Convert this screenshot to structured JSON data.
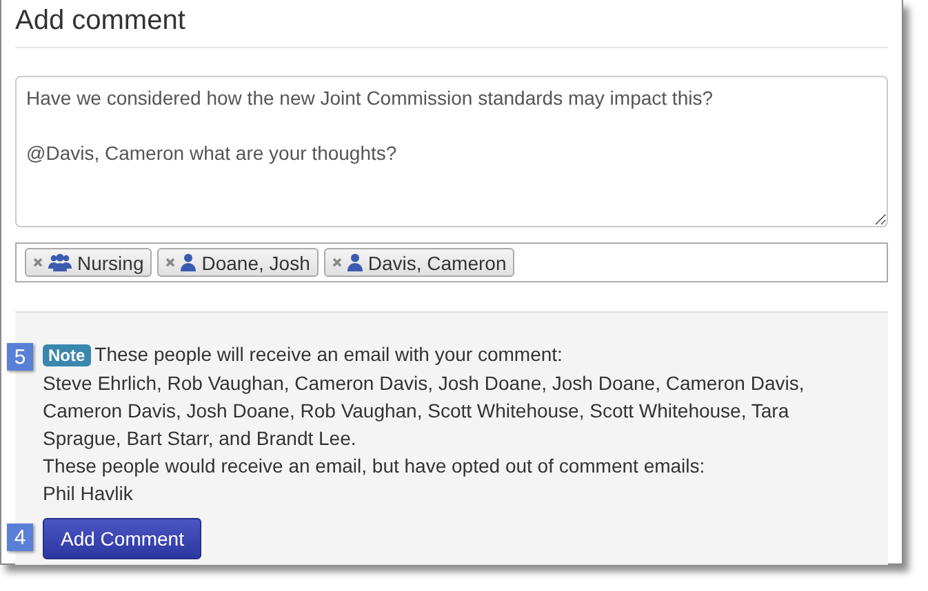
{
  "title": "Add comment",
  "comment": {
    "value": "Have we considered how the new Joint Commission standards may impact this?\n\n@Davis, Cameron what are your thoughts?"
  },
  "recipients": [
    {
      "kind": "group",
      "label": "Nursing"
    },
    {
      "kind": "person",
      "label": "Doane, Josh"
    },
    {
      "kind": "person",
      "label": "Davis, Cameron"
    }
  ],
  "notice": {
    "callout": "5",
    "badge": "Note",
    "heading": "These people will receive an email with your comment:",
    "recipients": "Steve Ehrlich, Rob Vaughan, Cameron Davis, Josh Doane, Josh Doane, Cameron Davis, Cameron Davis, Josh Doane, Rob Vaughan, Scott Whitehouse, Scott Whitehouse, Tara Sprague, Bart Starr, and Brandt Lee.",
    "opted_out_heading": "These people would receive an email, but have opted out of comment emails:",
    "opted_out": "Phil Havlik"
  },
  "submit": {
    "callout": "4",
    "label": "Add Comment"
  }
}
